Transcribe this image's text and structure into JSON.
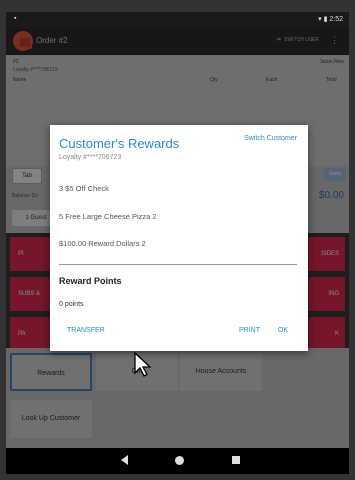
{
  "status_bar": {
    "time": "2:52"
  },
  "app_bar": {
    "title": "Order #2",
    "switch_user_label": "SWITCH USER"
  },
  "order": {
    "left_id": "#2",
    "server_name": "Jason Reis",
    "loyalty": "Loyalty #****706723",
    "columns": [
      "Name",
      "Qty",
      "Each",
      "Total"
    ]
  },
  "tab_label": "Tab",
  "side_button": "Send",
  "balance_label": "Balance Du",
  "guest_label": "1 Guest",
  "total_value": "$0.00",
  "categories": [
    "PI",
    "SIDES",
    "SUBS &",
    "ING",
    "PA",
    "K"
  ],
  "bottom_buttons": {
    "rewards": "Rewards",
    "gift": "Gift",
    "house_accounts": "House Accounts",
    "lookup": "Look Up Customer"
  },
  "dialog": {
    "title": "Customer's Rewards",
    "switch_customer": "Switch Customer",
    "loyalty": "Loyalty #****706723",
    "rewards": [
      "3 $5 Off Check",
      "5 Free Large Cheese Pizza 2",
      "$100.00 Reward Dollars 2"
    ],
    "section_title": "Reward Points",
    "points": "0 points",
    "buttons": {
      "transfer": "TRANSFER",
      "print": "PRINT",
      "ok": "OK"
    }
  },
  "colors": {
    "accent_blue": "#2d8bd1",
    "category_red": "#d6294e",
    "logo_orange": "#e0533a"
  }
}
